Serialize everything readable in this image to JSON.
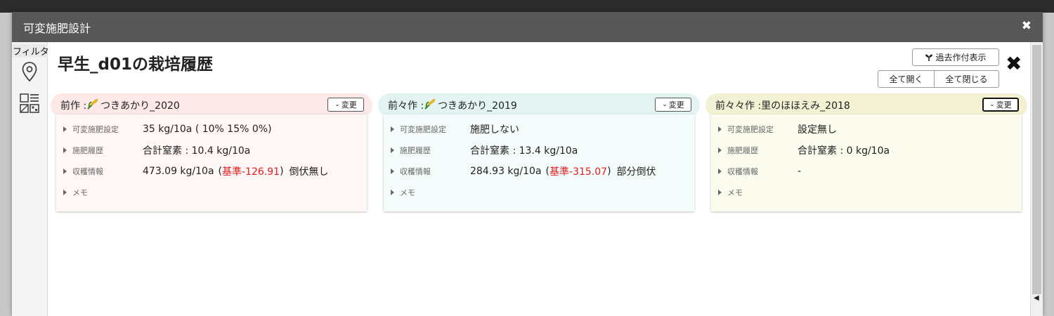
{
  "modal": {
    "title": "可変施肥設計"
  },
  "sidebar": {
    "filter_label": "フィルタ"
  },
  "page": {
    "title": "早生_d01の栽培履歴"
  },
  "toolbar": {
    "show_past": "過去作付表示",
    "expand_all": "全て開く",
    "collapse_all": "全て閉じる"
  },
  "cards": [
    {
      "title_prefix": "前作 : ",
      "title_name": "つきあかり_2020",
      "change_label": "変更",
      "has_leaf": true,
      "color": "#fde8e8",
      "body_color": "#fff6f6",
      "rows": {
        "vfs_label": "可変施肥設定",
        "vfs_value": "35 kg/10a ( 10% 15% 0%)",
        "fert_label": "施肥履歴",
        "fert_value": "合計窒素 : 10.4 kg/10a",
        "harvest_label": "収穫情報",
        "harvest_value": "473.09 kg/10a",
        "harvest_paren_open": "(",
        "harvest_diff": "基準-126.91",
        "harvest_paren_close": ")",
        "harvest_note": "倒伏無し",
        "memo_label": "メモ"
      }
    },
    {
      "title_prefix": "前々作 : ",
      "title_name": "つきあかり_2019",
      "change_label": "変更",
      "has_leaf": true,
      "color": "#e3f3f2",
      "body_color": "#f4fbfb",
      "rows": {
        "vfs_label": "可変施肥設定",
        "vfs_value": "施肥しない",
        "fert_label": "施肥履歴",
        "fert_value": "合計窒素 : 13.4 kg/10a",
        "harvest_label": "収穫情報",
        "harvest_value": "284.93 kg/10a",
        "harvest_paren_open": "(",
        "harvest_diff": "基準-315.07",
        "harvest_paren_close": ")",
        "harvest_note": "部分倒伏",
        "memo_label": "メモ"
      }
    },
    {
      "title_prefix": "前々々作 : ",
      "title_name": "里のほほえみ_2018",
      "change_label": "変更",
      "has_leaf": false,
      "color": "#f3f1d3",
      "body_color": "#fbfbee",
      "rows": {
        "vfs_label": "可変施肥設定",
        "vfs_value": "設定無し",
        "fert_label": "施肥履歴",
        "fert_value": "合計窒素 : 0 kg/10a",
        "harvest_label": "収穫情報",
        "harvest_value": "-",
        "harvest_paren_open": "",
        "harvest_diff": "",
        "harvest_paren_close": "",
        "harvest_note": "",
        "memo_label": "メモ"
      }
    }
  ]
}
